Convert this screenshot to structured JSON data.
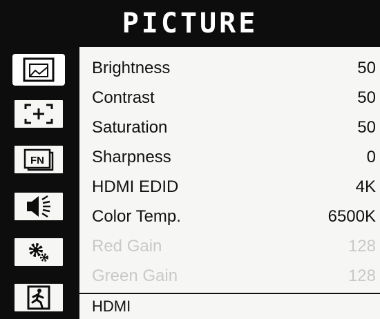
{
  "header": {
    "title": "PICTURE"
  },
  "sidebar": {
    "items": [
      {
        "icon": "picture-icon",
        "active": true
      },
      {
        "icon": "marker-crosshair-icon",
        "active": false
      },
      {
        "icon": "fn-key-icon",
        "active": false
      },
      {
        "icon": "speaker-icon",
        "active": false
      },
      {
        "icon": "gears-icon",
        "active": false
      },
      {
        "icon": "exit-icon",
        "active": false
      }
    ]
  },
  "menu": {
    "items": [
      {
        "label": "Brightness",
        "value": "50",
        "enabled": true
      },
      {
        "label": "Contrast",
        "value": "50",
        "enabled": true
      },
      {
        "label": "Saturation",
        "value": "50",
        "enabled": true
      },
      {
        "label": "Sharpness",
        "value": "0",
        "enabled": true
      },
      {
        "label": "HDMI EDID",
        "value": "4K",
        "enabled": true
      },
      {
        "label": "Color Temp.",
        "value": "6500K",
        "enabled": true
      },
      {
        "label": "Red Gain",
        "value": "128",
        "enabled": false
      },
      {
        "label": "Green Gain",
        "value": "128",
        "enabled": false
      }
    ]
  },
  "status": {
    "input_source": "HDMI"
  },
  "colors": {
    "bar": "#0d0d0d",
    "background": "#f6f6f4",
    "disabled_text": "#c9c9c9"
  }
}
